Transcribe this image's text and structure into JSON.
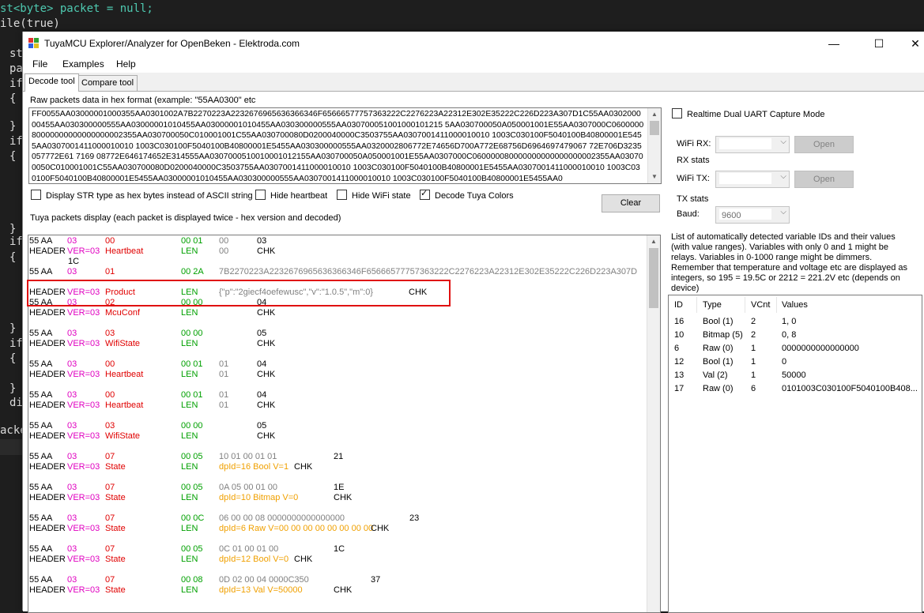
{
  "editor": {
    "lines": [
      "st<byte> packet = null;",
      "ile(true)",
      "st",
      "pa",
      "if",
      "{",
      "}",
      "if",
      "{",
      "}",
      "if",
      "{",
      "}",
      "if",
      "{",
      "}",
      "di",
      "acke"
    ]
  },
  "window": {
    "title": "TuyaMCU Explorer/Analyzer for OpenBeken - Elektroda.com",
    "minimize": "—",
    "maximize": "☐",
    "close": "✕"
  },
  "menu": [
    "File",
    "Examples",
    "Help"
  ],
  "tabs": [
    "Decode tool",
    "Compare tool"
  ],
  "raw": {
    "label": "Raw packets data in hex format (example: \"55AA0300\" etc",
    "text": "FF0055AA03000001000355AA0301002A7B2270223A2232676965636366346F65666577757363222C2276223A22312E302E35222C226D223A307D1C55AA030200000455AA030300000555AA03000001010455AA03000001010455AA030300000555AA030700051001000101215 5AA030700050A050001001E55AA0307000C060000080000000000000000002355AA030700050C010001001C55AA030700080D0200040000C3503755AA0307001411000010010 1003C030100F5040100B40800001E5455AA0307001411000010010 1003C030100F5040100B40800001E5455AA030300000555AA0320002806772E74656D700A772E68756D6964697479067 72E706D3235057772E61 7169 08772E646174652E314555AA0307000510010001012155AA030700050A050001001E55AA0307000C060000080000000000000000002355AA030700050C010001001C55AA030700080D0200040000C3503755AA0307001411000010010 1003C030100F5040100B40800001E5455AA0307001411000010010 1003C030100F5040100B40800001E5455AA03000001010455AA030300000555AA0307001411000010010 1003C030100F5040100B40800001E5455AA0"
  },
  "options": {
    "str_hex": "Display STR type as hex bytes instead of ASCII string",
    "hide_heartbeat": "Hide heartbeat",
    "hide_wifi": "Hide WiFi state",
    "decode_colors": "Decode Tuya Colors"
  },
  "clear_label": "Clear",
  "packets_label": "Tuya packets display (each packet is displayed twice - hex version and decoded)",
  "packets": [
    {
      "h": "55 AA",
      "v": "03",
      "c": "00",
      "l": "00 01",
      "d": "00",
      "k": "03",
      "hh": "HEADER",
      "vv": "VER=03",
      "cn": "Heartbeat",
      "ll": "LEN",
      "dd": "00",
      "kk": "CHK"
    },
    {
      "h": "55 AA",
      "v": "03",
      "c": "01",
      "l": "00 2A",
      "d": "7B2270223A2232676965636366346F65666577757363222C2276223A22312E302E35222C226D223A307D",
      "k": "1C",
      "hh": "HEADER",
      "vv": "VER=03",
      "cn": "Product",
      "ll": "LEN",
      "dd": "{\"p\":\"2giecf4oefewusc\",\"v\":\"1.0.5\",\"m\":0}",
      "kk": "CHK"
    },
    {
      "h": "55 AA",
      "v": "03",
      "c": "02",
      "l": "00 00",
      "d": "",
      "k": "04",
      "hh": "HEADER",
      "vv": "VER=03",
      "cn": "McuConf",
      "ll": "LEN",
      "dd": "",
      "kk": "CHK"
    },
    {
      "h": "55 AA",
      "v": "03",
      "c": "03",
      "l": "00 00",
      "d": "",
      "k": "05",
      "hh": "HEADER",
      "vv": "VER=03",
      "cn": "WifiState",
      "ll": "LEN",
      "dd": "",
      "kk": "CHK"
    },
    {
      "h": "55 AA",
      "v": "03",
      "c": "00",
      "l": "00 01",
      "d": "01",
      "k": "04",
      "hh": "HEADER",
      "vv": "VER=03",
      "cn": "Heartbeat",
      "ll": "LEN",
      "dd": "01",
      "kk": "CHK"
    },
    {
      "h": "55 AA",
      "v": "03",
      "c": "00",
      "l": "00 01",
      "d": "01",
      "k": "04",
      "hh": "HEADER",
      "vv": "VER=03",
      "cn": "Heartbeat",
      "ll": "LEN",
      "dd": "01",
      "kk": "CHK"
    },
    {
      "h": "55 AA",
      "v": "03",
      "c": "03",
      "l": "00 00",
      "d": "",
      "k": "05",
      "hh": "HEADER",
      "vv": "VER=03",
      "cn": "WifiState",
      "ll": "LEN",
      "dd": "",
      "kk": "CHK"
    },
    {
      "h": "55 AA",
      "v": "03",
      "c": "07",
      "l": "00 05",
      "d": "10 01 00 01 01",
      "k": "21",
      "hh": "HEADER",
      "vv": "VER=03",
      "cn": "State",
      "ll": "LEN",
      "dd": "dpId=16 Bool V=1",
      "kk": "CHK"
    },
    {
      "h": "55 AA",
      "v": "03",
      "c": "07",
      "l": "00 05",
      "d": "0A 05 00 01 00",
      "k": "1E",
      "hh": "HEADER",
      "vv": "VER=03",
      "cn": "State",
      "ll": "LEN",
      "dd": "dpId=10 Bitmap V=0",
      "kk": "CHK"
    },
    {
      "h": "55 AA",
      "v": "03",
      "c": "07",
      "l": "00 0C",
      "d": "06 00 00 08 0000000000000000",
      "k": "23",
      "hh": "HEADER",
      "vv": "VER=03",
      "cn": "State",
      "ll": "LEN",
      "dd": "dpId=6 Raw V=00 00 00 00 00 00 00 00",
      "kk": "CHK"
    },
    {
      "h": "55 AA",
      "v": "03",
      "c": "07",
      "l": "00 05",
      "d": "0C 01 00 01 00",
      "k": "1C",
      "hh": "HEADER",
      "vv": "VER=03",
      "cn": "State",
      "ll": "LEN",
      "dd": "dpId=12 Bool V=0",
      "kk": "CHK"
    },
    {
      "h": "55 AA",
      "v": "03",
      "c": "07",
      "l": "00 08",
      "d": "0D 02 00 04 0000C350",
      "k": "37",
      "hh": "HEADER",
      "vv": "VER=03",
      "cn": "State",
      "ll": "LEN",
      "dd": "dpId=13 Val V=50000",
      "kk": "CHK"
    }
  ],
  "right": {
    "realtime": "Realtime Dual UART Capture Mode",
    "wifi_rx": "WiFi RX:",
    "rx_stats": "RX stats",
    "wifi_tx": "WiFi TX:",
    "tx_stats": "TX stats",
    "baud": "Baud:",
    "baud_value": "9600",
    "open": "Open",
    "info": "List of automatically detected variable IDs  and their values (with value ranges). Variables with only 0 and 1 might be relays. Variables in 0-1000 range might be dimmers. Remember that temperature and voltage etc are displayed as integers, so 195 = 19.5C or 2212 = 221.2V etc (depends on device)"
  },
  "vars": {
    "headers": [
      "ID",
      "Type",
      "VCnt",
      "Values"
    ],
    "rows": [
      [
        "16",
        "Bool (1)",
        "2",
        "1, 0"
      ],
      [
        "10",
        "Bitmap (5)",
        "2",
        "0, 8"
      ],
      [
        "6",
        "Raw (0)",
        "1",
        "0000000000000000"
      ],
      [
        "12",
        "Bool (1)",
        "1",
        "0"
      ],
      [
        "13",
        "Val (2)",
        "1",
        "50000"
      ],
      [
        "17",
        "Raw (0)",
        "6",
        "0101003C030100F5040100B408..."
      ]
    ]
  },
  "colors": {
    "red": "#e00000",
    "magenta": "#e000c0",
    "green": "#00a000",
    "gray": "#808080",
    "orange": "#f0a000",
    "highlight": "#e01010"
  }
}
